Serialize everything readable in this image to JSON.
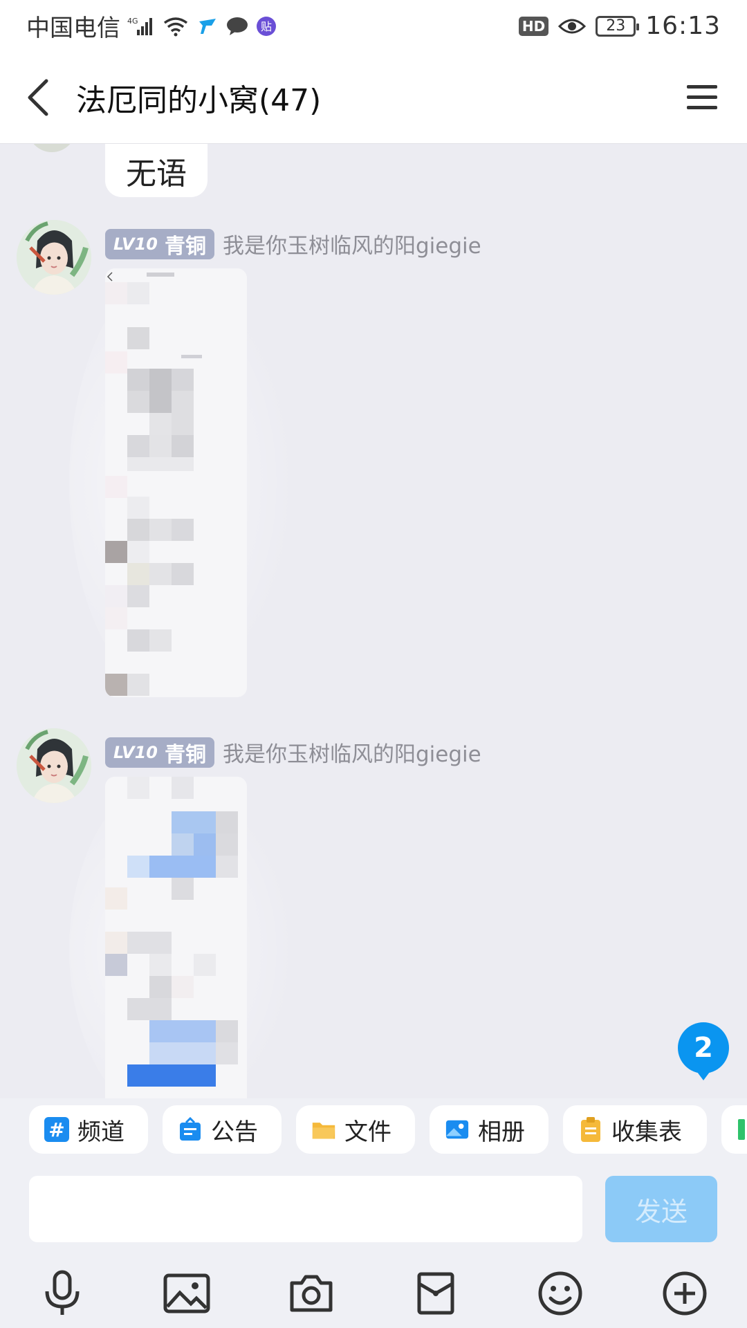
{
  "status_bar": {
    "carrier": "中国电信",
    "network": "4G",
    "hd": "HD",
    "battery": "23",
    "time": "16:13",
    "app_badge": "贴"
  },
  "header": {
    "title": "法厄同的小窝(47)"
  },
  "messages": [
    {
      "type": "text",
      "text": "无语"
    },
    {
      "type": "image",
      "level": "LV10",
      "rank": "青铜",
      "nickname": "我是你玉树临风的阳giegie"
    },
    {
      "type": "image",
      "level": "LV10",
      "rank": "青铜",
      "nickname": "我是你玉树临风的阳giegie"
    }
  ],
  "unread_count": "2",
  "quick_tools": [
    {
      "label": "频道",
      "icon": "hash-icon",
      "color": "#1a8cf0"
    },
    {
      "label": "公告",
      "icon": "announcement-icon",
      "color": "#1a8cf0"
    },
    {
      "label": "文件",
      "icon": "folder-icon",
      "color": "#f5b93a"
    },
    {
      "label": "相册",
      "icon": "album-icon",
      "color": "#1a8cf0"
    },
    {
      "label": "收集表",
      "icon": "clipboard-icon",
      "color": "#f5b93a"
    }
  ],
  "input": {
    "placeholder": "",
    "send_label": "发送"
  },
  "toolbar_icons": [
    "microphone-icon",
    "image-icon",
    "camera-icon",
    "red-packet-icon",
    "emoji-icon",
    "plus-icon"
  ],
  "colors": {
    "accent": "#0a95f0",
    "send_disabled": "#8ccaf7",
    "level_badge": "#a6adc6",
    "chat_bg": "#ececf2"
  }
}
